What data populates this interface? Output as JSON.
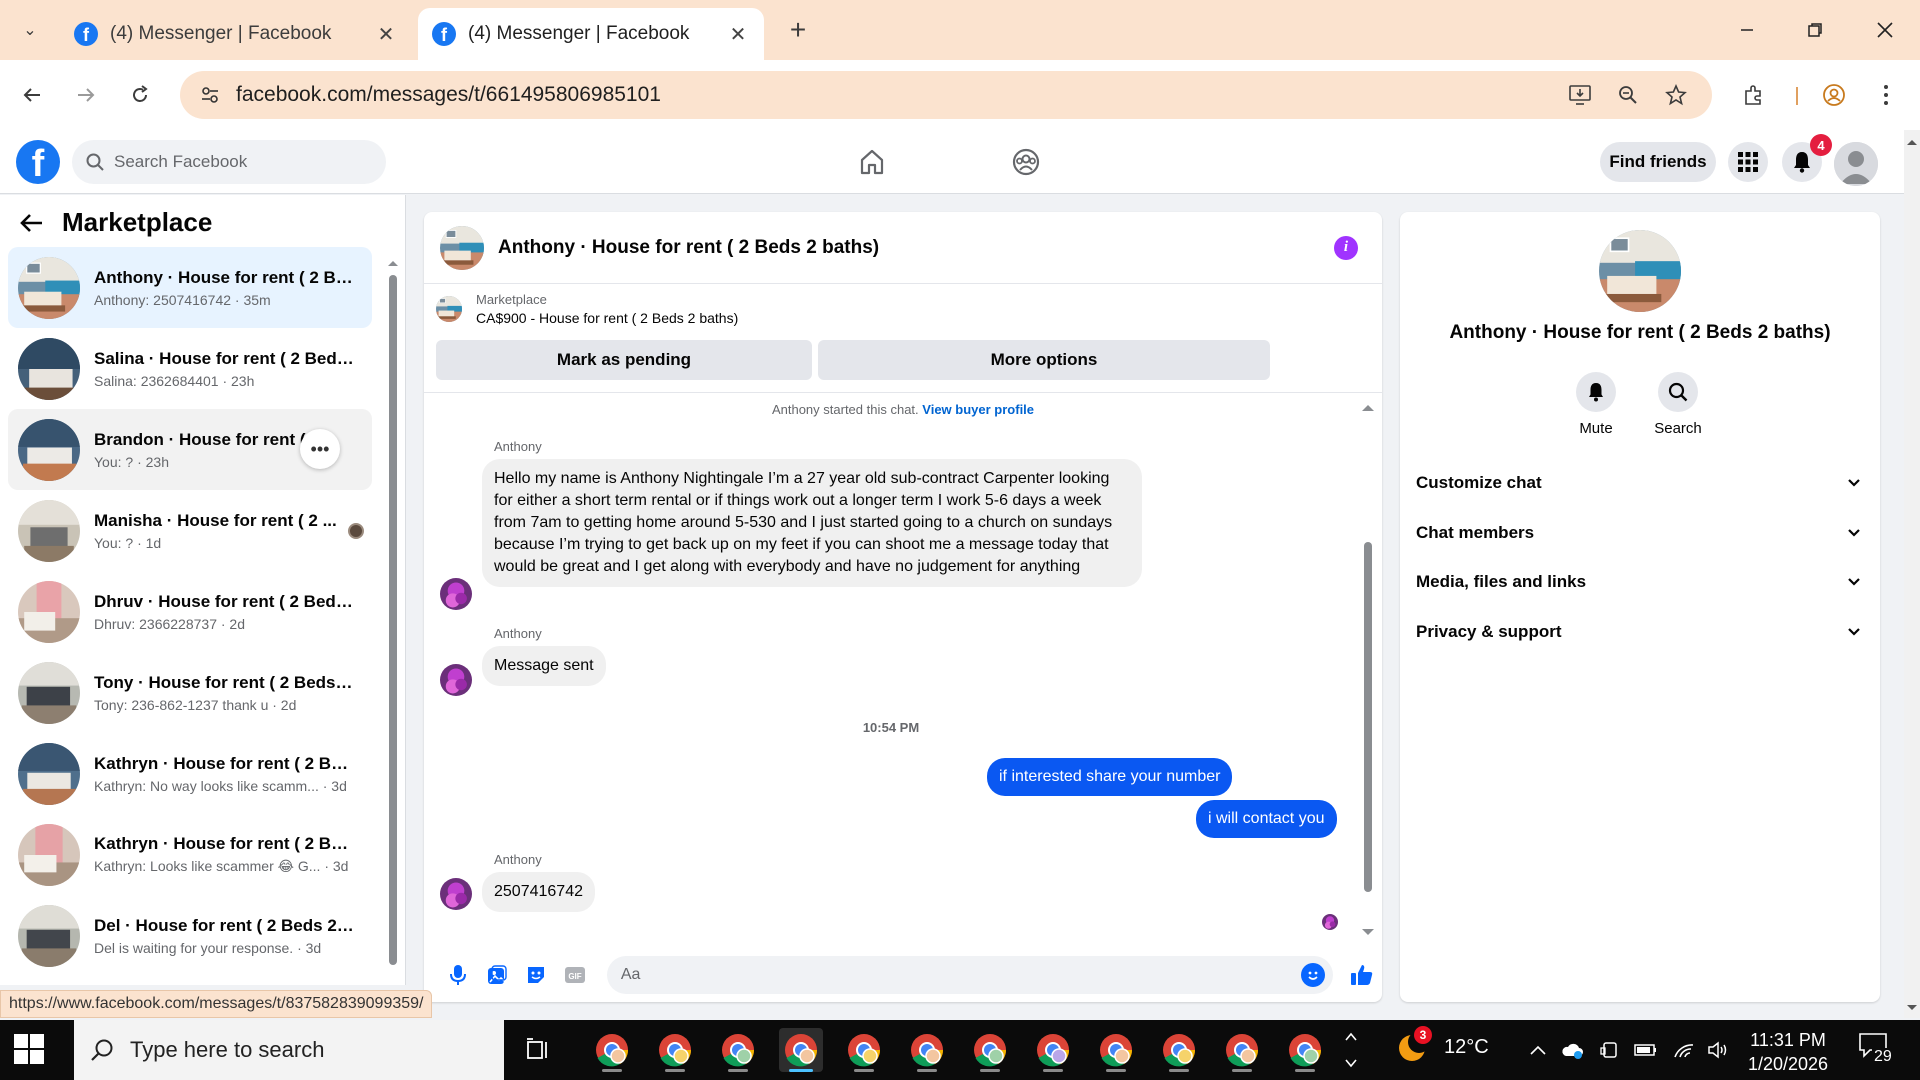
{
  "browser": {
    "tabs": [
      {
        "title": "(4) Messenger | Facebook",
        "active": false
      },
      {
        "title": "(4) Messenger | Facebook",
        "active": true
      }
    ],
    "url": "facebook.com/messages/t/661495806985101",
    "status_url": "https://www.facebook.com/messages/t/837582839099359/"
  },
  "fb": {
    "search_placeholder": "Search Facebook",
    "find_friends": "Find friends",
    "notification_count": "4"
  },
  "sidebar": {
    "title": "Marketplace",
    "conversations": [
      {
        "name": "Anthony · House for rent ( 2 Be...",
        "preview": "Anthony: 2507416742 · 35m",
        "active": true
      },
      {
        "name": "Salina · House for rent ( 2 Beds ...",
        "preview": "Salina: 2362684401 · 23h"
      },
      {
        "name": "Brandon · House for rent ( 2 ...",
        "preview": "You: ? · 23h",
        "hover": true
      },
      {
        "name": "Manisha · House for rent ( 2 ...",
        "preview": "You: ? · 1d"
      },
      {
        "name": "Dhruv · House for rent ( 2 Beds ...",
        "preview": "Dhruv: 2366228737 · 2d"
      },
      {
        "name": "Tony · House for rent ( 2 Beds 2...",
        "preview": "Tony: 236-862-1237 thank u · 2d"
      },
      {
        "name": "Kathryn · House for rent ( 2 Be...",
        "preview": "Kathryn: No way looks like scamm... · 3d"
      },
      {
        "name": "Kathryn · House for rent ( 2 Be...",
        "preview": "Kathryn: Looks like scammer 😂 G... · 3d"
      },
      {
        "name": "Del · House for rent ( 2 Beds 2 ...",
        "preview": "Del is waiting for your response. · 3d"
      }
    ]
  },
  "chat": {
    "title": "Anthony · House for rent ( 2 Beds 2 baths)",
    "marketplace_label": "Marketplace",
    "listing": "CA$900 - House for rent ( 2 Beds 2 baths)",
    "mark_pending": "Mark as pending",
    "more_options": "More options",
    "started_text": "Anthony started this chat.",
    "view_buyer_profile": "View buyer profile",
    "messages": [
      {
        "sender": "Anthony",
        "text": "Hello my name is Anthony Nightingale I’m a 27 year old sub-contract Carpenter looking for either a short term rental or if things work out a longer term I work 5-6 days a week from 7am to getting home around 5-530 and I just started going to a church on sundays because I’m trying to get back up on my feet if you can shoot me a message today that would be great and I get along with everybody and have no judgement for anything"
      },
      {
        "sender": "Anthony",
        "text": "Message sent"
      },
      {
        "sender": "You",
        "text": "if interested share your number"
      },
      {
        "sender": "You",
        "text": "i will contact you"
      },
      {
        "sender": "Anthony",
        "text": "2507416742"
      }
    ],
    "timestamp": "10:54 PM",
    "composer_placeholder": "Aa"
  },
  "info_panel": {
    "name": "Anthony · House for rent ( 2 Beds 2 baths)",
    "actions": [
      "Mute",
      "Search"
    ],
    "sections": [
      "Customize chat",
      "Chat members",
      "Media, files and links",
      "Privacy & support"
    ]
  },
  "taskbar": {
    "search_placeholder": "Type here to search",
    "weather_temp": "12°C",
    "weather_badge": "3",
    "time": "11:31 PM",
    "date": "1/20/2026",
    "notification_count": "29"
  },
  "colors": {
    "fb_blue": "#1877f2",
    "messenger_blue": "#0a58f2",
    "info_purple": "#a033ff",
    "browser_accent": "#fbe3cf",
    "active_conv": "#e7f3ff"
  }
}
